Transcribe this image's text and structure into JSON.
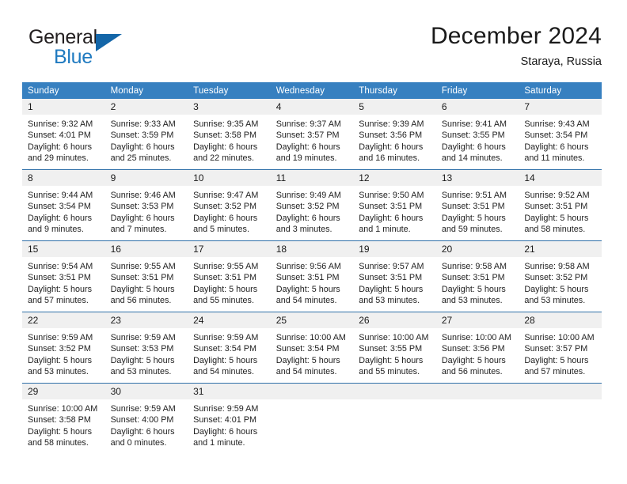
{
  "brand": {
    "word_one": "General",
    "word_two": "Blue",
    "accent_color": "#1466a8",
    "text_color": "#1f7ac0"
  },
  "header": {
    "title": "December 2024",
    "subtitle": "Staraya, Russia"
  },
  "calendar": {
    "header_color": "#3780c0",
    "weekday_headers": [
      "Sunday",
      "Monday",
      "Tuesday",
      "Wednesday",
      "Thursday",
      "Friday",
      "Saturday"
    ],
    "weeks": [
      [
        {
          "day": "1",
          "sunrise": "Sunrise: 9:32 AM",
          "sunset": "Sunset: 4:01 PM",
          "daylight_line1": "Daylight: 6 hours",
          "daylight_line2": "and 29 minutes."
        },
        {
          "day": "2",
          "sunrise": "Sunrise: 9:33 AM",
          "sunset": "Sunset: 3:59 PM",
          "daylight_line1": "Daylight: 6 hours",
          "daylight_line2": "and 25 minutes."
        },
        {
          "day": "3",
          "sunrise": "Sunrise: 9:35 AM",
          "sunset": "Sunset: 3:58 PM",
          "daylight_line1": "Daylight: 6 hours",
          "daylight_line2": "and 22 minutes."
        },
        {
          "day": "4",
          "sunrise": "Sunrise: 9:37 AM",
          "sunset": "Sunset: 3:57 PM",
          "daylight_line1": "Daylight: 6 hours",
          "daylight_line2": "and 19 minutes."
        },
        {
          "day": "5",
          "sunrise": "Sunrise: 9:39 AM",
          "sunset": "Sunset: 3:56 PM",
          "daylight_line1": "Daylight: 6 hours",
          "daylight_line2": "and 16 minutes."
        },
        {
          "day": "6",
          "sunrise": "Sunrise: 9:41 AM",
          "sunset": "Sunset: 3:55 PM",
          "daylight_line1": "Daylight: 6 hours",
          "daylight_line2": "and 14 minutes."
        },
        {
          "day": "7",
          "sunrise": "Sunrise: 9:43 AM",
          "sunset": "Sunset: 3:54 PM",
          "daylight_line1": "Daylight: 6 hours",
          "daylight_line2": "and 11 minutes."
        }
      ],
      [
        {
          "day": "8",
          "sunrise": "Sunrise: 9:44 AM",
          "sunset": "Sunset: 3:54 PM",
          "daylight_line1": "Daylight: 6 hours",
          "daylight_line2": "and 9 minutes."
        },
        {
          "day": "9",
          "sunrise": "Sunrise: 9:46 AM",
          "sunset": "Sunset: 3:53 PM",
          "daylight_line1": "Daylight: 6 hours",
          "daylight_line2": "and 7 minutes."
        },
        {
          "day": "10",
          "sunrise": "Sunrise: 9:47 AM",
          "sunset": "Sunset: 3:52 PM",
          "daylight_line1": "Daylight: 6 hours",
          "daylight_line2": "and 5 minutes."
        },
        {
          "day": "11",
          "sunrise": "Sunrise: 9:49 AM",
          "sunset": "Sunset: 3:52 PM",
          "daylight_line1": "Daylight: 6 hours",
          "daylight_line2": "and 3 minutes."
        },
        {
          "day": "12",
          "sunrise": "Sunrise: 9:50 AM",
          "sunset": "Sunset: 3:51 PM",
          "daylight_line1": "Daylight: 6 hours",
          "daylight_line2": "and 1 minute."
        },
        {
          "day": "13",
          "sunrise": "Sunrise: 9:51 AM",
          "sunset": "Sunset: 3:51 PM",
          "daylight_line1": "Daylight: 5 hours",
          "daylight_line2": "and 59 minutes."
        },
        {
          "day": "14",
          "sunrise": "Sunrise: 9:52 AM",
          "sunset": "Sunset: 3:51 PM",
          "daylight_line1": "Daylight: 5 hours",
          "daylight_line2": "and 58 minutes."
        }
      ],
      [
        {
          "day": "15",
          "sunrise": "Sunrise: 9:54 AM",
          "sunset": "Sunset: 3:51 PM",
          "daylight_line1": "Daylight: 5 hours",
          "daylight_line2": "and 57 minutes."
        },
        {
          "day": "16",
          "sunrise": "Sunrise: 9:55 AM",
          "sunset": "Sunset: 3:51 PM",
          "daylight_line1": "Daylight: 5 hours",
          "daylight_line2": "and 56 minutes."
        },
        {
          "day": "17",
          "sunrise": "Sunrise: 9:55 AM",
          "sunset": "Sunset: 3:51 PM",
          "daylight_line1": "Daylight: 5 hours",
          "daylight_line2": "and 55 minutes."
        },
        {
          "day": "18",
          "sunrise": "Sunrise: 9:56 AM",
          "sunset": "Sunset: 3:51 PM",
          "daylight_line1": "Daylight: 5 hours",
          "daylight_line2": "and 54 minutes."
        },
        {
          "day": "19",
          "sunrise": "Sunrise: 9:57 AM",
          "sunset": "Sunset: 3:51 PM",
          "daylight_line1": "Daylight: 5 hours",
          "daylight_line2": "and 53 minutes."
        },
        {
          "day": "20",
          "sunrise": "Sunrise: 9:58 AM",
          "sunset": "Sunset: 3:51 PM",
          "daylight_line1": "Daylight: 5 hours",
          "daylight_line2": "and 53 minutes."
        },
        {
          "day": "21",
          "sunrise": "Sunrise: 9:58 AM",
          "sunset": "Sunset: 3:52 PM",
          "daylight_line1": "Daylight: 5 hours",
          "daylight_line2": "and 53 minutes."
        }
      ],
      [
        {
          "day": "22",
          "sunrise": "Sunrise: 9:59 AM",
          "sunset": "Sunset: 3:52 PM",
          "daylight_line1": "Daylight: 5 hours",
          "daylight_line2": "and 53 minutes."
        },
        {
          "day": "23",
          "sunrise": "Sunrise: 9:59 AM",
          "sunset": "Sunset: 3:53 PM",
          "daylight_line1": "Daylight: 5 hours",
          "daylight_line2": "and 53 minutes."
        },
        {
          "day": "24",
          "sunrise": "Sunrise: 9:59 AM",
          "sunset": "Sunset: 3:54 PM",
          "daylight_line1": "Daylight: 5 hours",
          "daylight_line2": "and 54 minutes."
        },
        {
          "day": "25",
          "sunrise": "Sunrise: 10:00 AM",
          "sunset": "Sunset: 3:54 PM",
          "daylight_line1": "Daylight: 5 hours",
          "daylight_line2": "and 54 minutes."
        },
        {
          "day": "26",
          "sunrise": "Sunrise: 10:00 AM",
          "sunset": "Sunset: 3:55 PM",
          "daylight_line1": "Daylight: 5 hours",
          "daylight_line2": "and 55 minutes."
        },
        {
          "day": "27",
          "sunrise": "Sunrise: 10:00 AM",
          "sunset": "Sunset: 3:56 PM",
          "daylight_line1": "Daylight: 5 hours",
          "daylight_line2": "and 56 minutes."
        },
        {
          "day": "28",
          "sunrise": "Sunrise: 10:00 AM",
          "sunset": "Sunset: 3:57 PM",
          "daylight_line1": "Daylight: 5 hours",
          "daylight_line2": "and 57 minutes."
        }
      ],
      [
        {
          "day": "29",
          "sunrise": "Sunrise: 10:00 AM",
          "sunset": "Sunset: 3:58 PM",
          "daylight_line1": "Daylight: 5 hours",
          "daylight_line2": "and 58 minutes."
        },
        {
          "day": "30",
          "sunrise": "Sunrise: 9:59 AM",
          "sunset": "Sunset: 4:00 PM",
          "daylight_line1": "Daylight: 6 hours",
          "daylight_line2": "and 0 minutes."
        },
        {
          "day": "31",
          "sunrise": "Sunrise: 9:59 AM",
          "sunset": "Sunset: 4:01 PM",
          "daylight_line1": "Daylight: 6 hours",
          "daylight_line2": "and 1 minute."
        },
        {
          "day": "",
          "sunrise": "",
          "sunset": "",
          "daylight_line1": "",
          "daylight_line2": ""
        },
        {
          "day": "",
          "sunrise": "",
          "sunset": "",
          "daylight_line1": "",
          "daylight_line2": ""
        },
        {
          "day": "",
          "sunrise": "",
          "sunset": "",
          "daylight_line1": "",
          "daylight_line2": ""
        },
        {
          "day": "",
          "sunrise": "",
          "sunset": "",
          "daylight_line1": "",
          "daylight_line2": ""
        }
      ]
    ]
  }
}
